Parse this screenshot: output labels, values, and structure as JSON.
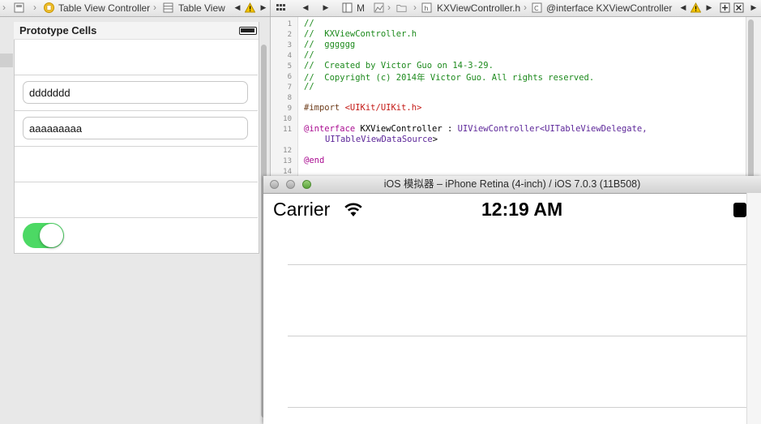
{
  "jump_bar": {
    "left": [
      {
        "label": "Table View Controller",
        "icon": "view-controller-icon"
      },
      {
        "label": "Table View",
        "icon": "table-view-icon"
      }
    ],
    "right": [
      {
        "label": "M",
        "icon": "file-m-icon"
      },
      {
        "label": "KXViewController.h",
        "icon": "header-file-icon"
      },
      {
        "label": "@interface KXViewController",
        "icon": "class-icon"
      }
    ]
  },
  "storyboard": {
    "section_title": "Prototype Cells",
    "text_fields": [
      "ddddddd",
      "aaaaaaaaa"
    ],
    "switch_on": true,
    "colors": {
      "switch_on": "#4cd964"
    }
  },
  "editor": {
    "lines": [
      {
        "n": "1",
        "text": "//"
      },
      {
        "n": "2",
        "text": "//  KXViewController.h"
      },
      {
        "n": "3",
        "text": "//  gggggg"
      },
      {
        "n": "4",
        "text": "//"
      },
      {
        "n": "5",
        "text": "//  Created by Victor Guo on 14-3-29."
      },
      {
        "n": "6",
        "text": "//  Copyright (c) 2014年 Victor Guo. All rights reserved."
      },
      {
        "n": "7",
        "text": "//"
      },
      {
        "n": "8",
        "text": ""
      },
      {
        "n": "9",
        "text_pre": "#import ",
        "text_str": "<UIKit/UIKit.h>"
      },
      {
        "n": "10",
        "text": ""
      },
      {
        "n": "11",
        "text_key": "@interface",
        "text_cls": " KXViewController : ",
        "text_super": "UIViewController",
        "text_proto1": "<UITableViewDelegate,"
      },
      {
        "n": "",
        "text_proto2": "UITableViewDataSource",
        "text_close": ">"
      },
      {
        "n": "12",
        "text": ""
      },
      {
        "n": "13",
        "text_end": "@end"
      },
      {
        "n": "14",
        "text": ""
      }
    ]
  },
  "simulator": {
    "window_title": "iOS 模拟器 – iPhone Retina (4-inch) / iOS 7.0.3 (11B508)",
    "carrier": "Carrier",
    "time": "12:19 AM"
  }
}
